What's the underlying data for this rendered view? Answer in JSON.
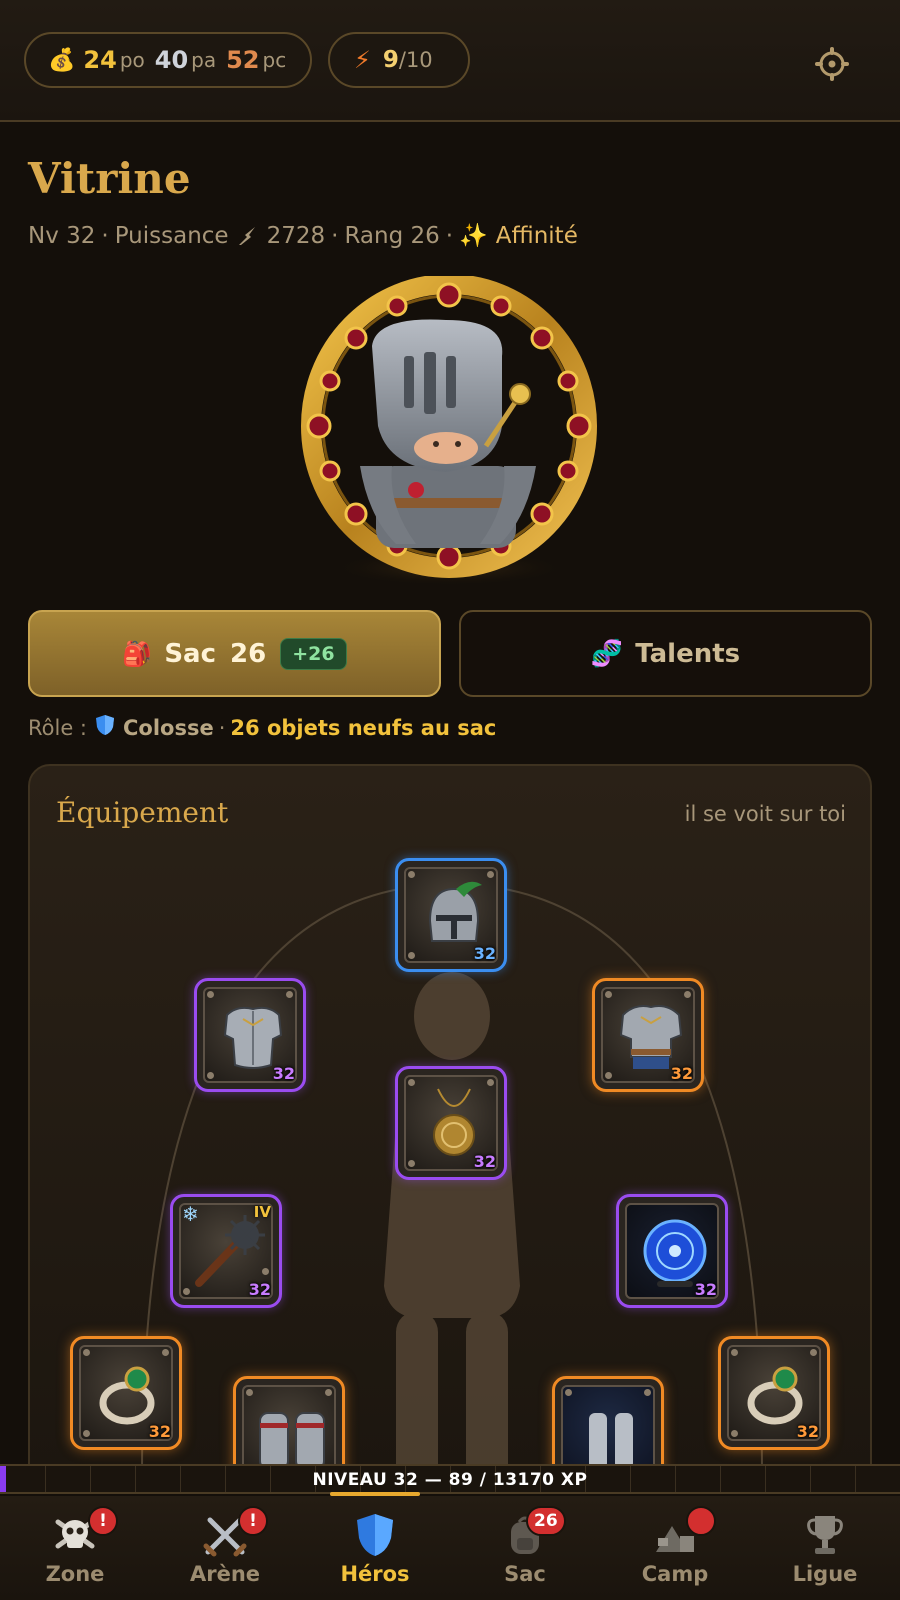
{
  "currency": {
    "gold": "24",
    "gold_unit": "po",
    "silver": "40",
    "silver_unit": "pa",
    "copper": "52",
    "copper_unit": "pc"
  },
  "energy": {
    "current": "9",
    "max": "/10"
  },
  "header": {
    "title": "Vitrine",
    "level": "Nv 32",
    "power_label": "Puissance",
    "power_value": "2728",
    "rank": "Rang 26",
    "affinity": "Affinité",
    "separator": "·"
  },
  "actions": {
    "bag_label": "Sac",
    "bag_count": "26",
    "bag_new": "+26",
    "talents_label": "Talents"
  },
  "role": {
    "prefix": "Rôle :",
    "name": "Colosse",
    "new_items": "26 objets neufs au sac",
    "separator": "·"
  },
  "equipment": {
    "title": "Équipement",
    "hint": "il se voit sur toi",
    "slots": [
      {
        "name": "helmet",
        "level": "32",
        "rarity": "blue"
      },
      {
        "name": "chest",
        "level": "32",
        "rarity": "purple"
      },
      {
        "name": "armor",
        "level": "32",
        "rarity": "orange"
      },
      {
        "name": "amulet",
        "level": "32",
        "rarity": "purple"
      },
      {
        "name": "mace",
        "level": "32",
        "rarity": "purple",
        "tier": "IV"
      },
      {
        "name": "orb",
        "level": "32",
        "rarity": "purple"
      },
      {
        "name": "ring-left",
        "level": "32",
        "rarity": "orange"
      },
      {
        "name": "gloves",
        "level": "",
        "rarity": "orange"
      },
      {
        "name": "boots",
        "level": "",
        "rarity": "orange"
      },
      {
        "name": "ring-right",
        "level": "32",
        "rarity": "orange"
      }
    ]
  },
  "xp": {
    "label": "NIVEAU 32 — 89 / 13170 XP",
    "fraction": 0.0068
  },
  "nav": {
    "items": [
      {
        "label": "Zone",
        "icon": "skull-icon",
        "badge": "!"
      },
      {
        "label": "Arène",
        "icon": "crossed-swords-icon",
        "badge": "!"
      },
      {
        "label": "Héros",
        "icon": "shield-icon",
        "badge": ""
      },
      {
        "label": "Sac",
        "icon": "backpack-icon",
        "badge": "26"
      },
      {
        "label": "Camp",
        "icon": "camp-icon",
        "badge": ""
      },
      {
        "label": "Ligue",
        "icon": "trophy-icon",
        "badge": ""
      }
    ]
  },
  "colors": {
    "accent_gold": "#d9a84c",
    "rarity_blue": "#3b8ef0",
    "rarity_purple": "#9a4cf0",
    "rarity_orange": "#f08a24",
    "badge_red": "#d32f2f"
  }
}
